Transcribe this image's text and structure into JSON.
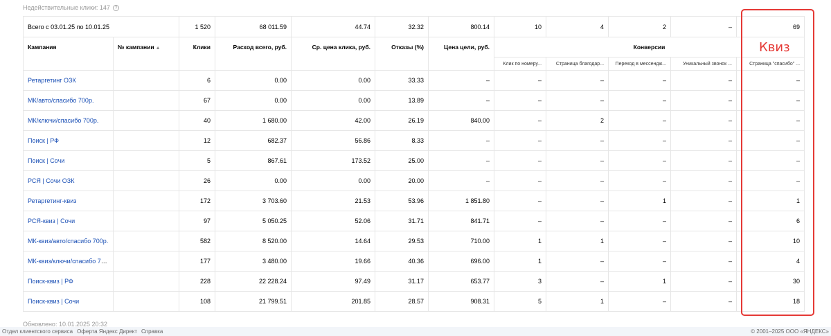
{
  "invalid_clicks": "Недействительные клики: 147",
  "help_glyph": "?",
  "total": {
    "label": "Всего с 03.01.25 по 10.01.25",
    "clicks": "1 520",
    "spend": "68 011.59",
    "cpc": "44.74",
    "bounce": "32.32",
    "goal_price": "800.14",
    "c1": "10",
    "c2": "4",
    "c3": "2",
    "c4": "–",
    "c5": "69"
  },
  "headers": {
    "campaign": "Кампания",
    "campaign_no": "№ кампании",
    "sort_glyph": "▲",
    "clicks": "Клики",
    "spend": "Расход всего, руб.",
    "cpc": "Ср. цена клика, руб.",
    "bounce": "Отказы (%)",
    "goal_price": "Цена цели, руб.",
    "conversions": "Конверсии",
    "conv_cols": [
      "Клик по номеру...",
      "Страница благодар...",
      "Переход в мессендж...",
      "Уникальный звонок ...",
      "Страница \"спасибо\" ..."
    ]
  },
  "rows": [
    {
      "name": "Ретаргетинг ОЗК",
      "clicks": "6",
      "spend": "0.00",
      "cpc": "0.00",
      "bounce": "33.33",
      "goal": "–",
      "c1": "–",
      "c2": "–",
      "c3": "–",
      "c4": "–",
      "c5": "–"
    },
    {
      "name": "МК/авто/спасибо 700р.",
      "clicks": "67",
      "spend": "0.00",
      "cpc": "0.00",
      "bounce": "13.89",
      "goal": "–",
      "c1": "–",
      "c2": "–",
      "c3": "–",
      "c4": "–",
      "c5": "–"
    },
    {
      "name": "МК/ключи/спасибо 700р.",
      "clicks": "40",
      "spend": "1 680.00",
      "cpc": "42.00",
      "bounce": "26.19",
      "goal": "840.00",
      "c1": "–",
      "c2": "2",
      "c3": "–",
      "c4": "–",
      "c5": "–"
    },
    {
      "name": "Поиск | РФ",
      "clicks": "12",
      "spend": "682.37",
      "cpc": "56.86",
      "bounce": "8.33",
      "goal": "–",
      "c1": "–",
      "c2": "–",
      "c3": "–",
      "c4": "–",
      "c5": "–"
    },
    {
      "name": "Поиск | Сочи",
      "clicks": "5",
      "spend": "867.61",
      "cpc": "173.52",
      "bounce": "25.00",
      "goal": "–",
      "c1": "–",
      "c2": "–",
      "c3": "–",
      "c4": "–",
      "c5": "–"
    },
    {
      "name": "РСЯ | Сочи ОЗК",
      "clicks": "26",
      "spend": "0.00",
      "cpc": "0.00",
      "bounce": "20.00",
      "goal": "–",
      "c1": "–",
      "c2": "–",
      "c3": "–",
      "c4": "–",
      "c5": "–"
    },
    {
      "name": "Ретаргетинг-квиз",
      "clicks": "172",
      "spend": "3 703.60",
      "cpc": "21.53",
      "bounce": "53.96",
      "goal": "1 851.80",
      "c1": "–",
      "c2": "–",
      "c3": "1",
      "c4": "–",
      "c5": "1"
    },
    {
      "name": "РСЯ-квиз | Сочи",
      "clicks": "97",
      "spend": "5 050.25",
      "cpc": "52.06",
      "bounce": "31.71",
      "goal": "841.71",
      "c1": "–",
      "c2": "–",
      "c3": "–",
      "c4": "–",
      "c5": "6"
    },
    {
      "name": "МК-квиз/авто/спасибо 700р.",
      "clicks": "582",
      "spend": "8 520.00",
      "cpc": "14.64",
      "bounce": "29.53",
      "goal": "710.00",
      "c1": "1",
      "c2": "1",
      "c3": "–",
      "c4": "–",
      "c5": "10"
    },
    {
      "name": "МК-квиз/ключи/спасибо 700р.",
      "clicks": "177",
      "spend": "3 480.00",
      "cpc": "19.66",
      "bounce": "40.36",
      "goal": "696.00",
      "c1": "1",
      "c2": "–",
      "c3": "–",
      "c4": "–",
      "c5": "4"
    },
    {
      "name": "Поиск-квиз | РФ",
      "clicks": "228",
      "spend": "22 228.24",
      "cpc": "97.49",
      "bounce": "31.17",
      "goal": "653.77",
      "c1": "3",
      "c2": "–",
      "c3": "1",
      "c4": "–",
      "c5": "30"
    },
    {
      "name": "Поиск-квиз | Сочи",
      "clicks": "108",
      "spend": "21 799.51",
      "cpc": "201.85",
      "bounce": "28.57",
      "goal": "908.31",
      "c1": "5",
      "c2": "1",
      "c3": "–",
      "c4": "–",
      "c5": "18"
    }
  ],
  "annotation": "Квиз",
  "updated": "Обновлено: 10.01.2025 20:32",
  "footer": {
    "links": [
      "Отдел клиентского сервиса",
      "Оферта Яндекс Директ",
      "Справка"
    ],
    "copyright": "© 2001–2025 ООО «ЯНДЕКС»"
  },
  "colors": {
    "link": "#1a4fb5",
    "annotation": "#e53935",
    "muted": "#999999"
  }
}
